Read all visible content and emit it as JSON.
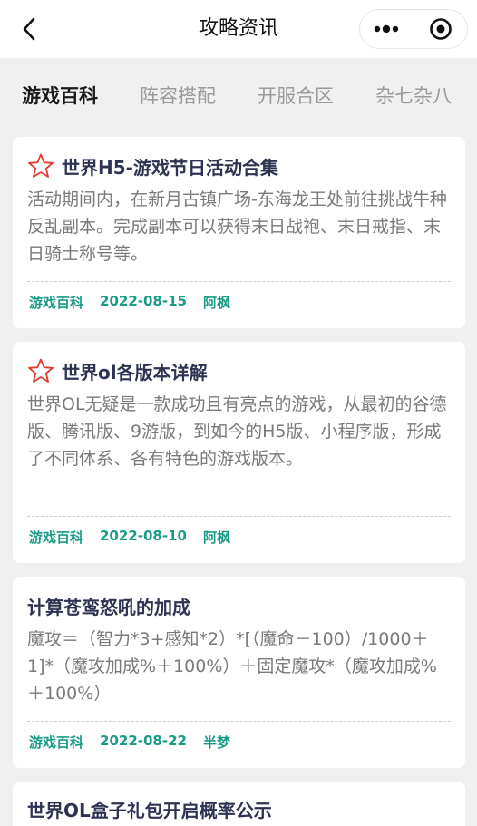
{
  "nav": {
    "title": "攻略资讯",
    "icons": {
      "back": "chevron-left-icon",
      "more": "more-dots-icon",
      "close": "target-circle-icon"
    }
  },
  "tabs": [
    {
      "label": "游戏百科",
      "active": true
    },
    {
      "label": "阵容搭配",
      "active": false
    },
    {
      "label": "开服合区",
      "active": false
    },
    {
      "label": "杂七杂八",
      "active": false
    }
  ],
  "articles": [
    {
      "title": "世界H5-游戏节日活动合集",
      "starred": true,
      "desc": "活动期间内，在新月古镇广场-东海龙王处前往挑战牛种反乱副本。完成副本可以获得末日战袍、末日戒指、末日骑士称号等。",
      "category": "游戏百科",
      "date": "2022-08-15",
      "author": "阿枫"
    },
    {
      "title": "世界ol各版本详解",
      "starred": true,
      "desc": "世界OL无疑是一款成功且有亮点的游戏，从最初的谷德版、腾讯版、9游版，到如今的H5版、小程序版，形成了不同体系、各有特色的游戏版本。",
      "category": "游戏百科",
      "date": "2022-08-10",
      "author": "阿枫"
    },
    {
      "title": "计算苍鸾怒吼的加成",
      "starred": false,
      "desc": "魔攻＝（智力*3+感知*2）*[（魔命－100）/1000＋1]*（魔攻加成%＋100%）＋固定魔攻*（魔攻加成%＋100%）",
      "category": "游戏百科",
      "date": "2022-08-22",
      "author": "半梦"
    },
    {
      "title": "世界OL盒子礼包开启概率公示",
      "starred": false
    }
  ],
  "colors": {
    "accent": "#1a9b86",
    "title": "#2e3353",
    "star": "#e03c2e"
  }
}
